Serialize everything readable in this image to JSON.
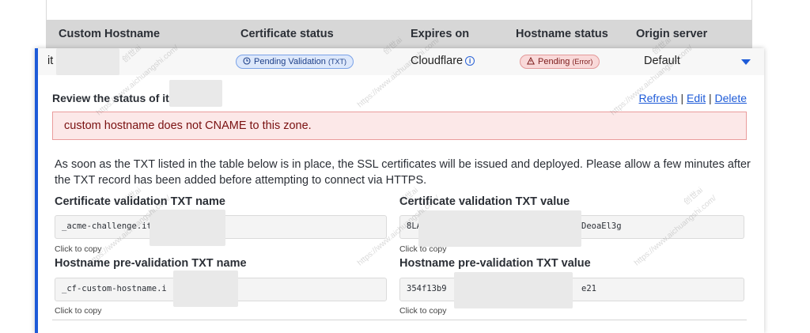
{
  "table": {
    "headers": [
      "Custom Hostname",
      "Certificate status",
      "Expires on",
      "Hostname status",
      "Origin server"
    ],
    "row": {
      "hostname_prefix": "it",
      "certificate_status": {
        "label": "Pending Validation",
        "suffix": "(TXT)"
      },
      "expires_on": "Cloudflare",
      "hostname_status": {
        "label": "Pending",
        "suffix": "(Error)"
      },
      "origin_server": "Default"
    }
  },
  "panel": {
    "review_title": "Review the status of it",
    "actions": {
      "refresh": "Refresh",
      "edit": "Edit",
      "delete": "Delete",
      "separator": "|"
    },
    "alert": "custom hostname does not CNAME to this zone.",
    "description": "As soon as the TXT listed in the table below is in place, the SSL certificates will be issued and deployed. Please allow a few minutes after the TXT record has been added before attempting to connect via HTTPS.",
    "cert_txt_name": {
      "label": "Certificate validation TXT name",
      "value": "_acme-challenge.it",
      "copy": "Click to copy"
    },
    "cert_txt_value": {
      "label": "Certificate validation TXT value",
      "value_start": "8LA",
      "value_end": "DeoaEl3g",
      "copy": "Click to copy"
    },
    "pre_txt_name": {
      "label": "Hostname pre-validation TXT name",
      "value": "_cf-custom-hostname.i",
      "copy": "Click to copy"
    },
    "pre_txt_value": {
      "label": "Hostname pre-validation TXT value",
      "value_start": "354f13b9",
      "value_end": "e21",
      "copy": "Click to copy"
    }
  },
  "icons": {
    "clock": "clock-icon",
    "info": "info-icon",
    "warning": "warning-icon",
    "caret": "caret-down-icon"
  },
  "colors": {
    "accent": "#1e5bd8",
    "alert_bg": "#fce8e8",
    "alert_text": "#7a1111"
  },
  "watermark": [
    "创世ai",
    "https://www.aichuangshi.com/"
  ]
}
